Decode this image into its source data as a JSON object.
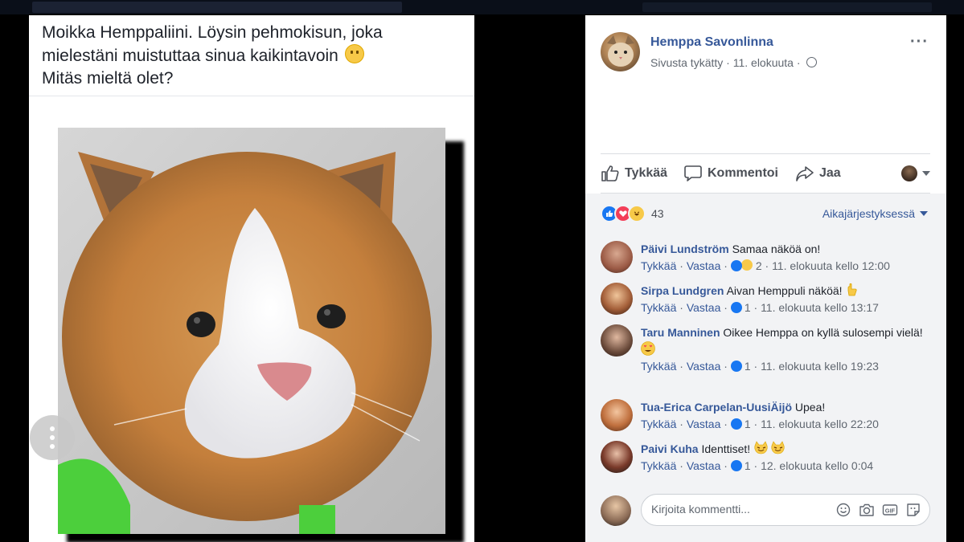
{
  "post": {
    "text_line1": "Moikka Hemppaliini. Löysin pehmokisun, joka",
    "text_line2": "mielestäni muistuttaa sinua kaikintavoin",
    "text_line3": "Mitäs mieltä olet?"
  },
  "page": {
    "name": "Hemppa Savonlinna",
    "meta": "Sivusta tykätty",
    "date": "11. elokuuta",
    "options": "···"
  },
  "actions": {
    "like": "Tykkää",
    "comment": "Kommentoi",
    "share": "Jaa"
  },
  "reactions": {
    "count": "43",
    "sort": "Aikajärjestyksessä"
  },
  "comments": [
    {
      "name": "Päivi Lundström",
      "text": "Samaa näköä on!",
      "like": "Tykkää",
      "reply": "Vastaa",
      "reacts": "2",
      "time": "11. elokuuta kello 12:00"
    },
    {
      "name": "Sirpa Lundgren",
      "text": "Aivan Hemppuli näköä!",
      "like": "Tykkää",
      "reply": "Vastaa",
      "reacts": "1",
      "time": "11. elokuuta kello 13:17"
    },
    {
      "name": "Taru Manninen",
      "text": "Oikee Hemppa on kyllä sulosempi vielä!",
      "like": "Tykkää",
      "reply": "Vastaa",
      "reacts": "1",
      "time": "11. elokuuta kello 19:23"
    },
    {
      "name": "Tua-Erica Carpelan-UusiÄijö",
      "text": "Upea!",
      "like": "Tykkää",
      "reply": "Vastaa",
      "reacts": "1",
      "time": "11. elokuuta kello 22:20"
    },
    {
      "name": "Paivi Kuha",
      "text": "Identtiset!",
      "like": "Tykkää",
      "reply": "Vastaa",
      "reacts": "1",
      "time": "12. elokuuta kello 0:04"
    }
  ],
  "composer": {
    "placeholder": "Kirjoita kommentti..."
  },
  "colors": {
    "link": "#365899",
    "like_blue": "#1877f2",
    "love_red": "#f33e58",
    "haha_yellow": "#f7c948"
  }
}
